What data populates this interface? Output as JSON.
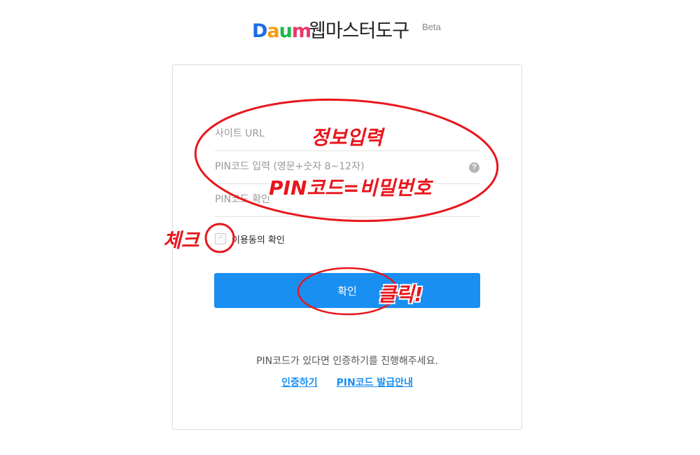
{
  "header": {
    "logo_letters": [
      "D",
      "a",
      "u",
      "m"
    ],
    "logo_colors": [
      "#1a6ce8",
      "#f39c12",
      "#19b94a",
      "#e8366b"
    ],
    "service_title": "웹마스터도구",
    "beta_label": "Beta"
  },
  "form": {
    "site_url_placeholder": "사이트 URL",
    "pin_placeholder": "PIN코드 입력 (영문+숫자 8~12자)",
    "pin_confirm_placeholder": "PIN코드 확인",
    "help_icon_glyph": "?",
    "agree_label": "이용동의 확인",
    "confirm_button": "확인"
  },
  "footer": {
    "guide_text": "PIN코드가 있다면 인증하기를 진행해주세요.",
    "link_verify": "인증하기",
    "link_pin_guide": "PIN코드 발급안내"
  },
  "annotations": {
    "info_input": "정보입력",
    "pin_note": "PIN코드=비밀번호",
    "check": "체크",
    "click": "클릭!"
  },
  "colors": {
    "accent": "#1a8ff2",
    "annotation": "#e8161c"
  }
}
